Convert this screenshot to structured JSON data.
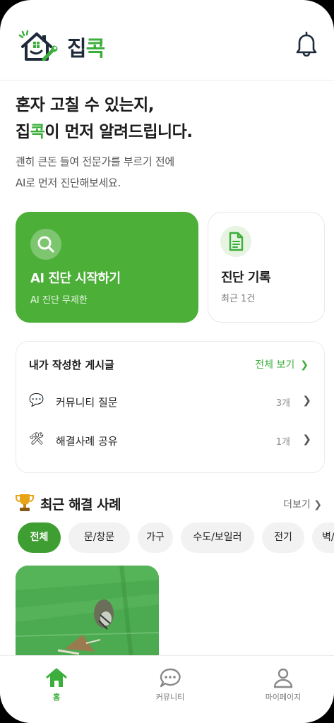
{
  "app": {
    "brand_prefix": "집",
    "brand_accent": "콕",
    "accent_color": "#3cae3c"
  },
  "hero": {
    "line1": "혼자 고칠 수 있는지,",
    "line2_accent_a": "집",
    "line2_accent_b": "콕",
    "line2_rest": "이 먼저 알려드립니다.",
    "sub1": "괜히 큰돈 들여 전문가를 부르기 전에",
    "sub2": "AI로 먼저 진단해보세요."
  },
  "cards": {
    "start": {
      "title": "AI 진단 시작하기",
      "subtitle": "AI 진단 무제한",
      "icon": "search-icon"
    },
    "history": {
      "title": "진단 기록",
      "subtitle": "최근 1건",
      "icon": "document-icon"
    }
  },
  "posts": {
    "title": "내가 작성한 게시글",
    "view_all": "전체 보기",
    "items": [
      {
        "icon": "💬",
        "label": "커뮤니티 질문",
        "count": "3개"
      },
      {
        "icon": "🛠",
        "label": "해결사례 공유",
        "count": "1개"
      }
    ]
  },
  "recent": {
    "icon": "trophy-icon",
    "title": "최근 해결 사례",
    "more": "더보기",
    "chips": [
      "전체",
      "문/창문",
      "가구",
      "수도/보일러",
      "전기",
      "벽/"
    ]
  },
  "nav": {
    "home": "홈",
    "community": "커뮤니티",
    "mypage": "마이페이지"
  }
}
